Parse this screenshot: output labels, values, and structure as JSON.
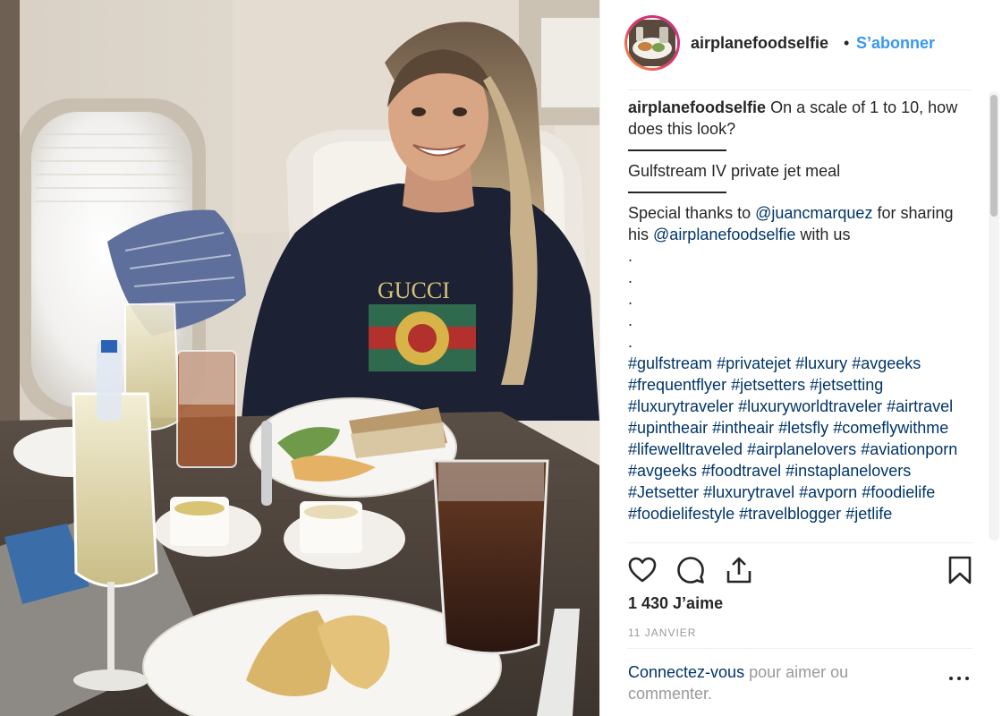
{
  "post": {
    "image_alt": "Woman seated at a table in a private jet cabin with plates of food, champagne and soda",
    "sweater_logo": "GUCCI"
  },
  "header": {
    "username": "airplanefoodselfie",
    "separator": "•",
    "follow_label": "S’abonner"
  },
  "caption": {
    "username": "airplanefoodselfie",
    "line1_text": "On a scale of 1 to 10, how does this look?",
    "subtitle": "Gulfstream IV private jet meal",
    "thanks_prefix": "Special thanks to",
    "mention1": "@juancmarquez",
    "thanks_middle": "for",
    "thanks_line2_prefix": "sharing his",
    "mention2": "@airplanefoodselfie",
    "thanks_suffix": "with us",
    "dots": [
      ".",
      ".",
      ".",
      ".",
      "."
    ],
    "hashtags": [
      "#gulfstream",
      "#privatejet",
      "#luxury",
      "#avgeeks",
      "#frequentflyer",
      "#jetsetters",
      "#jetsetting",
      "#luxurytraveler",
      "#luxuryworldtraveler",
      "#airtravel",
      "#upintheair",
      "#intheair",
      "#letsfly",
      "#comeflywithme",
      "#lifewelltraveled",
      "#airplanelovers",
      "#aviationporn",
      "#avgeeks",
      "#foodtravel",
      "#instaplanelovers",
      "#Jetsetter",
      "#luxurytravel",
      "#avporn",
      "#foodielife",
      "#foodielifestyle",
      "#travelblogger",
      "#jetlife"
    ]
  },
  "actions": {
    "like_icon": "heart-icon",
    "comment_icon": "comment-icon",
    "share_icon": "share-icon",
    "save_icon": "bookmark-icon"
  },
  "stats": {
    "likes": "1 430 J’aime",
    "date": "11 JANVIER"
  },
  "login": {
    "link": "Connectez-vous",
    "text": "pour aimer ou commenter."
  },
  "colors": {
    "accent": "#3897f0",
    "link": "#003569",
    "muted": "#999999",
    "text": "#262626"
  }
}
